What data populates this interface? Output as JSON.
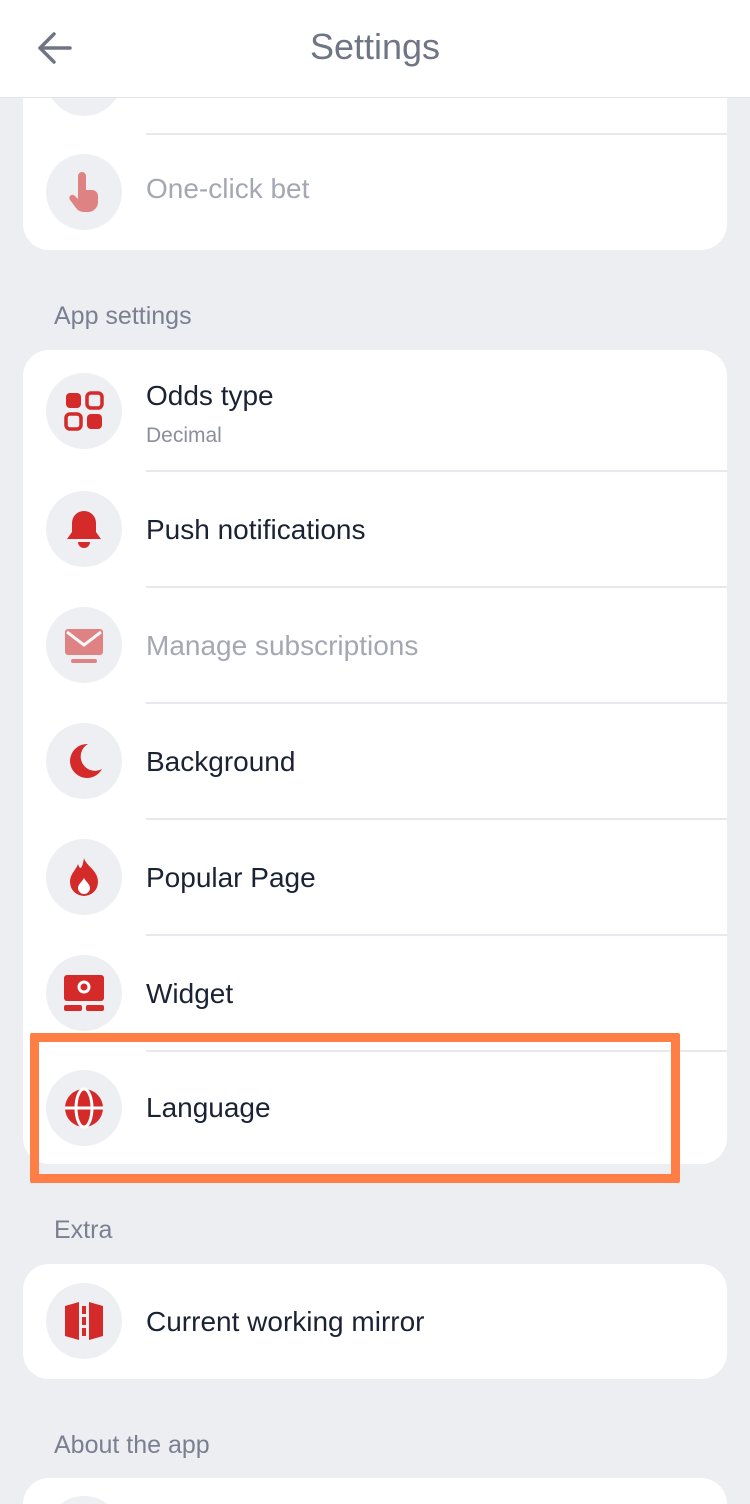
{
  "header": {
    "title": "Settings",
    "back_icon": "arrow-left-icon"
  },
  "top_card": {
    "items": [
      {
        "label": "One-click bet",
        "icon": "tap-finger-icon",
        "disabled": true
      }
    ]
  },
  "app_settings": {
    "title": "App settings",
    "items": [
      {
        "label": "Odds type",
        "sub": "Decimal",
        "icon": "grid-icon"
      },
      {
        "label": "Push notifications",
        "icon": "bell-icon"
      },
      {
        "label": "Manage subscriptions",
        "icon": "mail-icon",
        "disabled": true
      },
      {
        "label": "Background",
        "icon": "moon-icon"
      },
      {
        "label": "Popular Page",
        "icon": "flame-icon"
      },
      {
        "label": "Widget",
        "icon": "widget-icon"
      },
      {
        "label": "Language",
        "icon": "globe-icon",
        "highlighted": true
      }
    ]
  },
  "extra": {
    "title": "Extra",
    "items": [
      {
        "label": "Current working mirror",
        "icon": "mirror-icon"
      }
    ]
  },
  "about": {
    "title": "About the app"
  },
  "colors": {
    "accent": "#d42a2a",
    "highlight": "#ff7e45",
    "background": "#edeef2"
  }
}
